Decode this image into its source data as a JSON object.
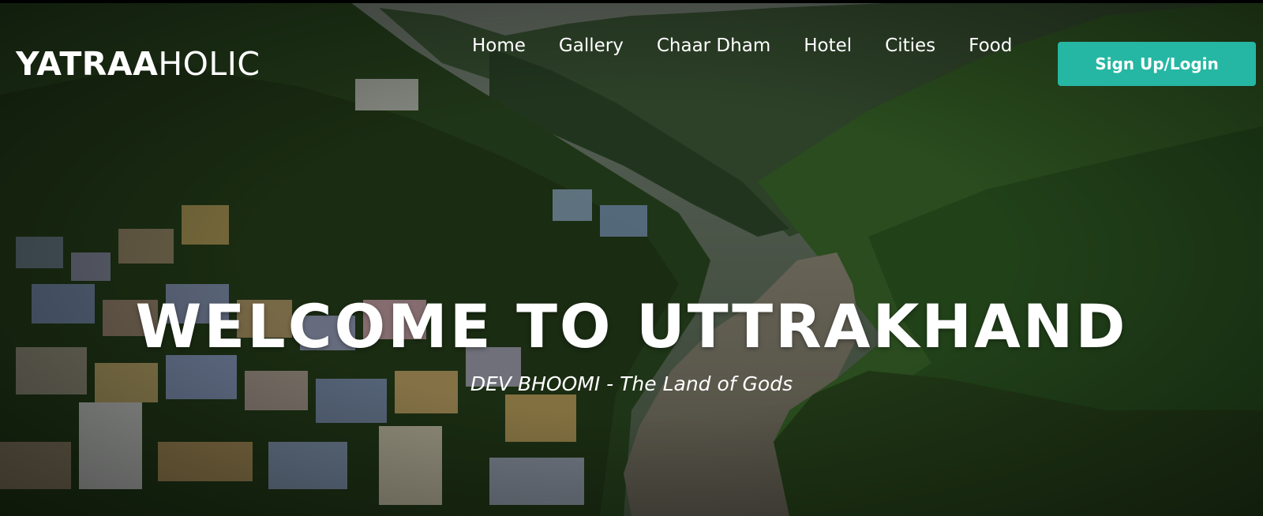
{
  "brand": {
    "bold": "YATRAA",
    "light": "HOLIC"
  },
  "nav": {
    "items": [
      {
        "label": "Home"
      },
      {
        "label": "Gallery"
      },
      {
        "label": "Chaar Dham"
      },
      {
        "label": "Hotel"
      },
      {
        "label": "Cities"
      },
      {
        "label": "Food"
      }
    ]
  },
  "auth": {
    "button_label": "Sign Up/Login"
  },
  "hero": {
    "headline": "WELCOME TO UTTRAKHAND",
    "tagline": "DEV BHOOMI - The Land of Gods",
    "image_description_icon": "mountain-valley-image"
  },
  "colors": {
    "accent": "#25b7a3",
    "text": "#ffffff"
  }
}
